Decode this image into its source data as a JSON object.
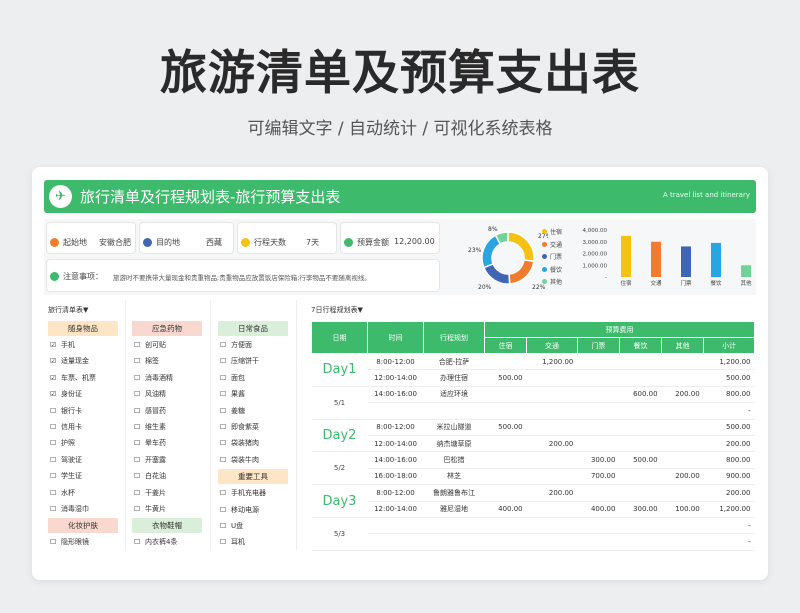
{
  "page": {
    "title": "旅游清单及预算支出表",
    "subtitle": "可编辑文字 / 自动统计 / 可视化系统表格"
  },
  "header": {
    "title": "旅行清单及行程规划表-旅行预算支出表",
    "english": "A travel list and itinerary"
  },
  "info": {
    "origin_label": "起始地",
    "origin": "安徽合肥",
    "dest_label": "目的地",
    "dest": "西藏",
    "days_label": "行程天数",
    "days": "7天",
    "budget_label": "预算金额",
    "budget": "12,200.00",
    "note_label": "注意事项：",
    "note": "旅游时不要携带大量现金和贵重物品;贵重物品应放置饭店保险箱;行李物品不要随离视线。"
  },
  "pie": {
    "labels": [
      "8%",
      "27%",
      "22%",
      "20%",
      "23%"
    ],
    "legend": [
      "住宿",
      "交通",
      "门票",
      "餐饮",
      "其他"
    ]
  },
  "chart_data": [
    {
      "type": "pie",
      "categories": [
        "住宿",
        "交通",
        "门票",
        "餐饮",
        "其他"
      ],
      "values": [
        27,
        22,
        20,
        23,
        8
      ],
      "colors": [
        "#f5c211",
        "#f07c2d",
        "#3f66b5",
        "#27a6e0",
        "#6fd39a"
      ]
    },
    {
      "type": "bar",
      "categories": [
        "住宿",
        "交通",
        "门票",
        "餐饮",
        "其他"
      ],
      "values": [
        3500,
        3000,
        2600,
        2900,
        1000
      ],
      "ylim": [
        0,
        4000
      ],
      "yticks": [
        "4,000.00",
        "3,000.00",
        "2,000.00",
        "1,000.00",
        "-"
      ],
      "colors": [
        "#f5c211",
        "#f07c2d",
        "#3f66b5",
        "#27a6e0",
        "#6fd39a"
      ]
    }
  ],
  "lists": {
    "head": "旅行清单表▼",
    "col1": {
      "tag": "随身物品",
      "items": [
        [
          "☑",
          "手机"
        ],
        [
          "☑",
          "适量现金"
        ],
        [
          "☑",
          "车票、机票"
        ],
        [
          "☑",
          "身份证"
        ],
        [
          "☐",
          "银行卡"
        ],
        [
          "☐",
          "信用卡"
        ],
        [
          "☐",
          "护照"
        ],
        [
          "☐",
          "驾驶证"
        ],
        [
          "☐",
          "学生证"
        ],
        [
          "☐",
          "水杯"
        ],
        [
          "☐",
          "消毒湿巾"
        ]
      ],
      "tag2": "化妆护肤",
      "items2": [
        [
          "☐",
          "隐形眼镜"
        ]
      ]
    },
    "col2": {
      "tag": "应急药物",
      "items": [
        [
          "☐",
          "创可贴"
        ],
        [
          "☐",
          "棉签"
        ],
        [
          "☐",
          "消毒酒精"
        ],
        [
          "☐",
          "风油精"
        ],
        [
          "☐",
          "感冒药"
        ],
        [
          "☐",
          "维生素"
        ],
        [
          "☐",
          "晕车药"
        ],
        [
          "☐",
          "开塞露"
        ],
        [
          "☐",
          "白花油"
        ],
        [
          "☐",
          "干姜片"
        ],
        [
          "☐",
          "牛黄片"
        ]
      ],
      "tag2": "衣物鞋帽",
      "items2": [
        [
          "☐",
          "内衣裤4条"
        ]
      ]
    },
    "col3": {
      "tag": "日常食品",
      "items": [
        [
          "☐",
          "方便面"
        ],
        [
          "☐",
          "压缩饼干"
        ],
        [
          "☐",
          "面包"
        ],
        [
          "☐",
          "果酱"
        ],
        [
          "☐",
          "姜糖"
        ],
        [
          "☐",
          "即食紫菜"
        ],
        [
          "☐",
          "袋装猪肉"
        ],
        [
          "☐",
          "袋装牛肉"
        ]
      ],
      "tag2": "重要工具",
      "items2": [
        [
          "☐",
          "手机充电器"
        ],
        [
          "☐",
          "移动电源"
        ],
        [
          "☐",
          "U盘"
        ],
        [
          "☐",
          "耳机"
        ]
      ]
    }
  },
  "schedule": {
    "head": "7日行程规划表▼",
    "cols": [
      "日期",
      "时间",
      "行程规划",
      "预算费用",
      "住宿",
      "交通",
      "门票",
      "餐饮",
      "其他",
      "小计"
    ],
    "days": [
      {
        "day": "Day1",
        "date": "5/1",
        "rows": [
          [
            "8:00-12:00",
            "合肥-拉萨",
            "",
            "1,200.00",
            "",
            "",
            "",
            "1,200.00"
          ],
          [
            "12:00-14:00",
            "办理住宿",
            "500.00",
            "",
            "",
            "",
            "",
            "500.00"
          ],
          [
            "14:00-16:00",
            "适应环境",
            "",
            "",
            "",
            "600.00",
            "200.00",
            "800.00"
          ],
          [
            "",
            "",
            "",
            "",
            "",
            "",
            "",
            "-"
          ]
        ]
      },
      {
        "day": "Day2",
        "date": "5/2",
        "rows": [
          [
            "8:00-12:00",
            "米拉山隧道",
            "500.00",
            "",
            "",
            "",
            "",
            "500.00"
          ],
          [
            "12:00-14:00",
            "纳杰塘草原",
            "",
            "200.00",
            "",
            "",
            "",
            "200.00"
          ],
          [
            "14:00-16:00",
            "巴松措",
            "",
            "",
            "300.00",
            "500.00",
            "",
            "800.00"
          ],
          [
            "16:00-18:00",
            "林芝",
            "",
            "",
            "700.00",
            "",
            "200.00",
            "900.00"
          ]
        ]
      },
      {
        "day": "Day3",
        "date": "5/3",
        "rows": [
          [
            "8:00-12:00",
            "鲁朗雅鲁布江",
            "",
            "200.00",
            "",
            "",
            "",
            "200.00"
          ],
          [
            "12:00-14:00",
            "雅尼湿地",
            "400.00",
            "",
            "400.00",
            "300.00",
            "100.00",
            "1,200.00"
          ],
          [
            "",
            "",
            "",
            "",
            "",
            "",
            "",
            "-"
          ],
          [
            "",
            "",
            "",
            "",
            "",
            "",
            "",
            "-"
          ]
        ]
      }
    ]
  }
}
